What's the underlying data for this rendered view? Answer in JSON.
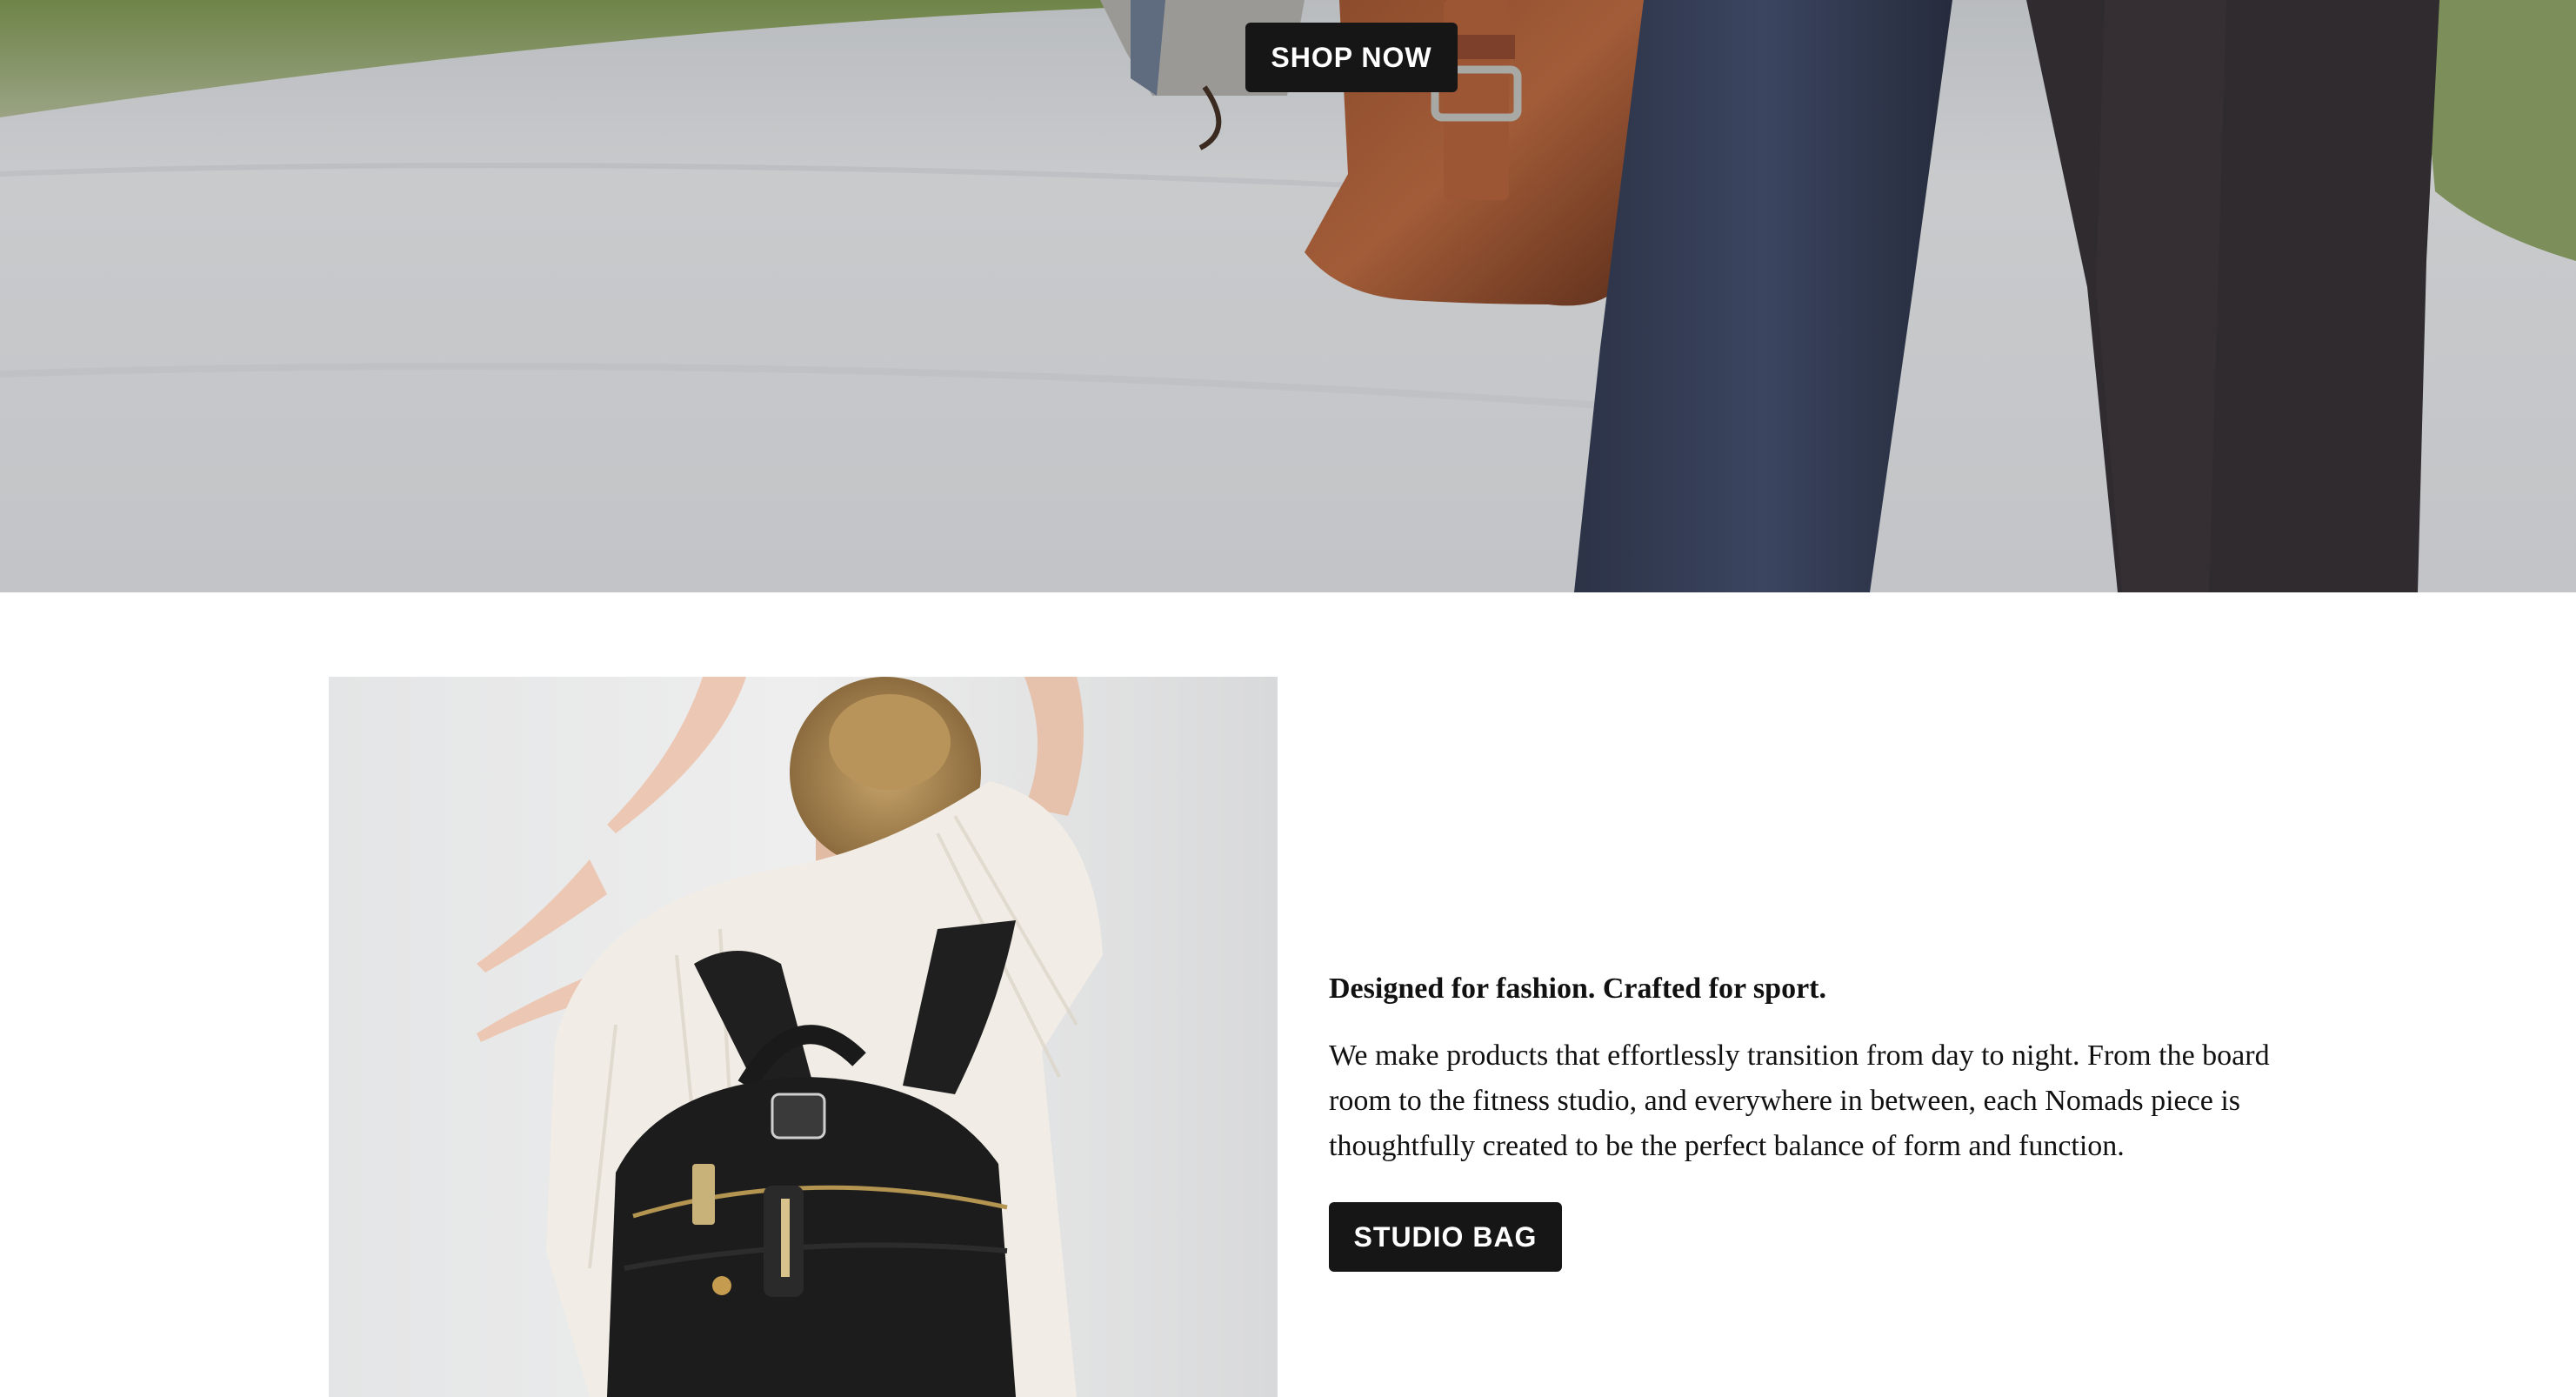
{
  "hero": {
    "cta_label": "SHOP NOW",
    "image_subject": "person-walking-with-leather-bag"
  },
  "feature": {
    "image_subject": "woman-wearing-black-backpack",
    "heading": "Designed for fashion. Crafted for sport.",
    "body": "We make products that effortlessly transition from day to night. From the board room to the fitness studio, and everywhere in between, each Nomads piece is thoughtfully created to be the perfect balance of form and function.",
    "cta_label": "STUDIO BAG"
  },
  "colors": {
    "button_bg": "#161616",
    "button_text": "#ffffff",
    "text": "#111111",
    "background": "#ffffff"
  }
}
